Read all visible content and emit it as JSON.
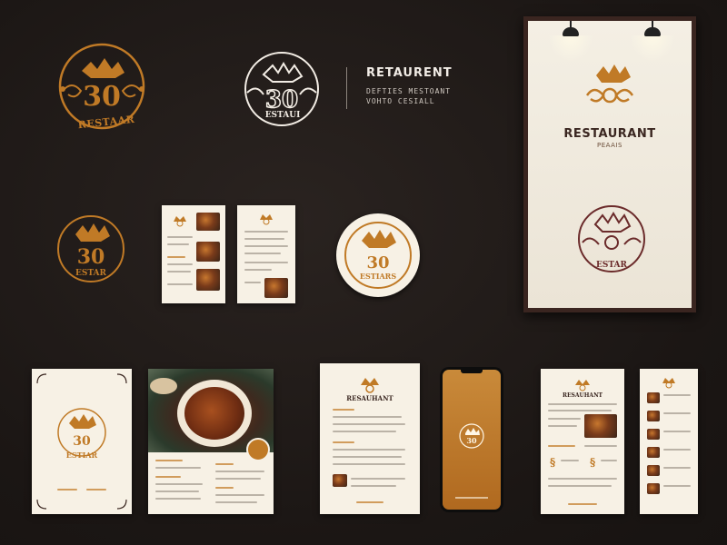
{
  "colors": {
    "gold": "#c07a26",
    "white": "#f2ece4",
    "maroon": "#6b2b2b",
    "background": "#1d1816",
    "paper": "#f7f1e5"
  },
  "logo_orange": {
    "text": "RESTAAR"
  },
  "logo_white": {
    "text": "ESTAUI"
  },
  "wordmark": {
    "title": "RETAURENT",
    "line1": "DEFTIES MESTOANT",
    "line2": "VOHTO CESIALL"
  },
  "logo_small": {
    "text": "ESTAR"
  },
  "badge": {
    "text": "ESTIARS"
  },
  "poster": {
    "title": "RESTAURANT",
    "subtitle": "PEAAIS",
    "stamp_text": "ESTAR"
  },
  "menu_cover": {
    "text": "ESTIAR"
  },
  "menu_card": {
    "title": "RESAUHANT"
  },
  "menu_right": {
    "title": "RESAUHANT"
  }
}
